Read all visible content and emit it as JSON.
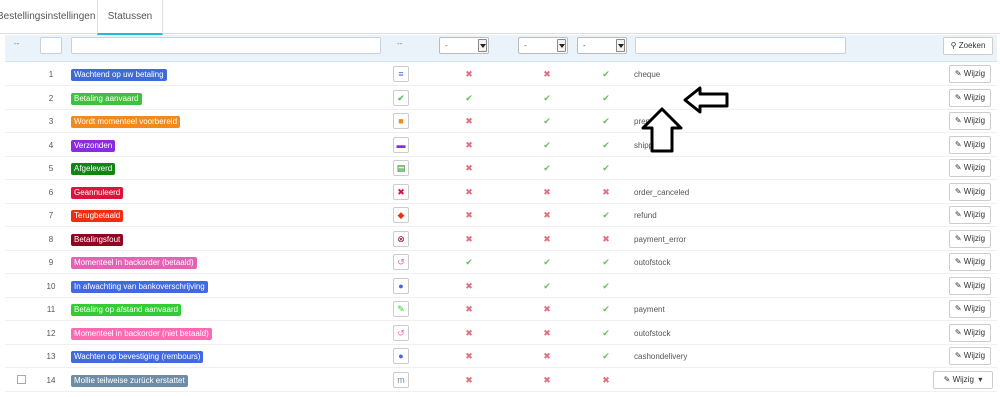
{
  "tabs": [
    {
      "label": "Bestellingsinstellingen"
    },
    {
      "label": "Statussen"
    }
  ],
  "filters": {
    "sort_glyph": "--",
    "select_value": "-",
    "search_label": "Zoeken"
  },
  "edit_label": "Wijzig",
  "colors": {
    "accent": "#25b9d7",
    "cross": "#e2707f",
    "check": "#6bbf5a"
  },
  "statuses": [
    {
      "id": "1",
      "name": "Wachtend op uw betaling",
      "color": "#3f6ad7",
      "icon": "cheque-icon",
      "glyph": "≡",
      "c1": "x",
      "c2": "x",
      "c3": "ok",
      "template": "cheque"
    },
    {
      "id": "2",
      "name": "Betaling aanvaard",
      "color": "#3ec13e",
      "icon": "check-icon",
      "glyph": "✔",
      "c1": "ok",
      "c2": "ok",
      "c3": "ok",
      "template": ""
    },
    {
      "id": "3",
      "name": "Wordt momenteel voorbereid",
      "color": "#f28a1b",
      "icon": "box-icon",
      "glyph": "■",
      "c1": "x",
      "c2": "ok",
      "c3": "ok",
      "template": "preparation"
    },
    {
      "id": "4",
      "name": "Verzonden",
      "color": "#8a2be2",
      "icon": "truck-icon",
      "glyph": "▬",
      "c1": "x",
      "c2": "ok",
      "c3": "ok",
      "template": "shipped"
    },
    {
      "id": "5",
      "name": "Afgeleverd",
      "color": "#108510",
      "icon": "package-icon",
      "glyph": "▤",
      "c1": "x",
      "c2": "ok",
      "c3": "ok",
      "template": ""
    },
    {
      "id": "6",
      "name": "Geannuleerd",
      "color": "#dc143c",
      "icon": "cancel-icon",
      "glyph": "✖",
      "c1": "x",
      "c2": "x",
      "c3": "x",
      "template": "order_canceled"
    },
    {
      "id": "7",
      "name": "Terugbetaald",
      "color": "#ec2e15",
      "icon": "refund-icon",
      "glyph": "◆",
      "c1": "x",
      "c2": "x",
      "c3": "ok",
      "template": "refund"
    },
    {
      "id": "8",
      "name": "Betalingsfout",
      "color": "#8f0621",
      "icon": "error-icon",
      "glyph": "⊗",
      "c1": "x",
      "c2": "x",
      "c3": "x",
      "template": "payment_error"
    },
    {
      "id": "9",
      "name": "Momenteel in backorder (betaald)",
      "color": "#e462b3",
      "icon": "backorder-icon",
      "glyph": "↺",
      "c1": "ok",
      "c2": "ok",
      "c3": "ok",
      "template": "outofstock"
    },
    {
      "id": "10",
      "name": "In afwachting van bankoverschrijving",
      "color": "#4169e1",
      "icon": "coins-icon",
      "glyph": "●",
      "c1": "x",
      "c2": "ok",
      "c3": "ok",
      "template": ""
    },
    {
      "id": "11",
      "name": "Betaling op afstand aanvaard",
      "color": "#32cd32",
      "icon": "pen-icon",
      "glyph": "✎",
      "c1": "x",
      "c2": "x",
      "c3": "ok",
      "template": "payment"
    },
    {
      "id": "12",
      "name": "Momenteel in backorder (niet betaald)",
      "color": "#ff69b4",
      "icon": "backorder-icon",
      "glyph": "↺",
      "c1": "x",
      "c2": "x",
      "c3": "ok",
      "template": "outofstock"
    },
    {
      "id": "13",
      "name": "Wachten op bevestiging (rembours)",
      "color": "#4169e1",
      "icon": "coins-icon",
      "glyph": "●",
      "c1": "x",
      "c2": "x",
      "c3": "ok",
      "template": "cashondelivery"
    },
    {
      "id": "14",
      "name": "Mollie teilweise zurück erstattet",
      "color": "#6f8ca6",
      "icon": "mollie-icon",
      "glyph": "m",
      "c1": "x",
      "c2": "x",
      "c3": "x",
      "template": ""
    }
  ]
}
